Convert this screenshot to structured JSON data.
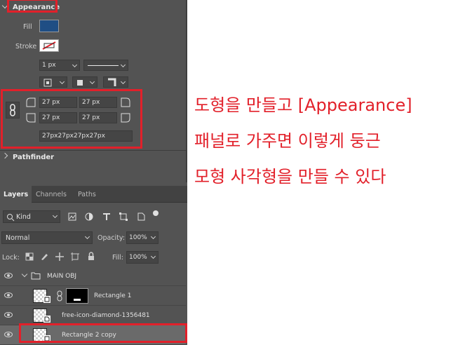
{
  "appearance": {
    "title": "Appearance",
    "fill_label": "Fill",
    "fill_color": "#1f4e84",
    "stroke_label": "Stroke",
    "stroke_width": "1 px",
    "corners": {
      "top_left": "27 px",
      "top_right": "27 px",
      "bottom_left": "27 px",
      "bottom_right": "27 px",
      "combined": "27px27px27px27px"
    }
  },
  "pathfinder": {
    "title": "Pathfinder"
  },
  "layers_panel": {
    "tabs": [
      "Layers",
      "Channels",
      "Paths"
    ],
    "filter_kind": "Kind",
    "blend_mode": "Normal",
    "opacity_label": "Opacity:",
    "opacity_value": "100%",
    "lock_label": "Lock:",
    "fill_label": "Fill:",
    "fill_value": "100%",
    "layers": [
      {
        "name": "MAIN OBJ",
        "type": "group"
      },
      {
        "name": "Rectangle 1",
        "type": "shape"
      },
      {
        "name": "free-icon-diamond-1356481",
        "type": "image"
      },
      {
        "name": "Rectangle 2 copy",
        "type": "shape"
      }
    ]
  },
  "annotation": {
    "line1": "도형을 만들고 [Appearance]",
    "line2": "패널로 가주면 이렇게 둥근",
    "line3": "모형 사각형을 만들 수 있다"
  },
  "colors": {
    "accent_red": "#e2202a",
    "panel_bg": "#535353"
  }
}
